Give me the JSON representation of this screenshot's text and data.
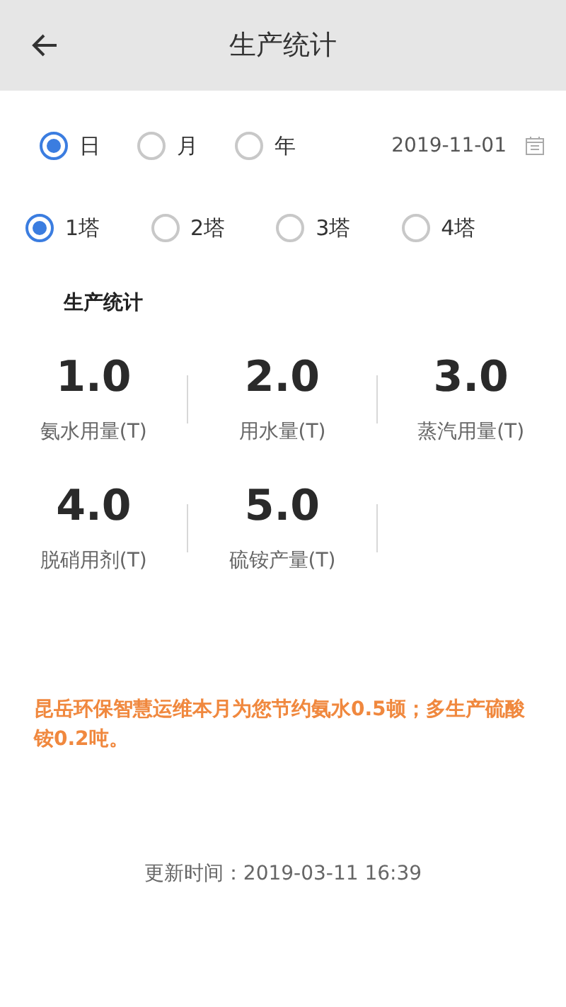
{
  "header": {
    "title": "生产统计"
  },
  "periods": [
    {
      "label": "日",
      "selected": true
    },
    {
      "label": "月",
      "selected": false
    },
    {
      "label": "年",
      "selected": false
    }
  ],
  "date": "2019-11-01",
  "towers": [
    {
      "label": "1塔",
      "selected": true
    },
    {
      "label": "2塔",
      "selected": false
    },
    {
      "label": "3塔",
      "selected": false
    },
    {
      "label": "4塔",
      "selected": false
    }
  ],
  "section_title": "生产统计",
  "stats": [
    {
      "value": "1.0",
      "label": "氨水用量(T)"
    },
    {
      "value": "2.0",
      "label": "用水量(T)"
    },
    {
      "value": "3.0",
      "label": "蒸汽用量(T)"
    },
    {
      "value": "4.0",
      "label": "脱硝用剂(T)"
    },
    {
      "value": "5.0",
      "label": "硫铵产量(T)"
    }
  ],
  "notice": "昆岳环保智慧运维本月为您节约氨水0.5顿；多生产硫酸铵0.2吨。",
  "updated": "更新时间：2019-03-11 16:39"
}
